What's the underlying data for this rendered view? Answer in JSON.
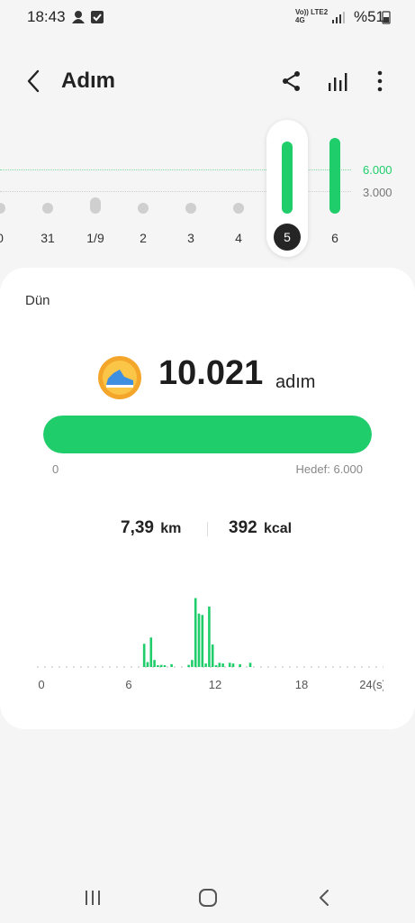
{
  "status": {
    "time": "18:43",
    "network": "Vo)) LTE2 4G",
    "battery": "%51",
    "icons": [
      "account-icon",
      "checkbox-icon",
      "volte-icon",
      "signal-icon",
      "battery-icon"
    ]
  },
  "header": {
    "title": "Adım",
    "icons": [
      "back-icon",
      "share-icon",
      "chart-icon",
      "more-icon"
    ]
  },
  "week": {
    "goal_label": "6.000",
    "ref_label": "3.000",
    "goal_color": "#1fce6b",
    "days": [
      {
        "label": "0",
        "steps": 0,
        "style": "dot"
      },
      {
        "label": "31",
        "steps": 0,
        "style": "dot"
      },
      {
        "label": "1/9",
        "steps": 2200,
        "style": "gray"
      },
      {
        "label": "2",
        "steps": 0,
        "style": "dot"
      },
      {
        "label": "3",
        "steps": 0,
        "style": "dot"
      },
      {
        "label": "4",
        "steps": 0,
        "style": "dot"
      },
      {
        "label": "5",
        "steps": 10021,
        "style": "green",
        "selected": true
      },
      {
        "label": "6",
        "steps": 10500,
        "style": "green"
      }
    ]
  },
  "summary": {
    "date": "Dün",
    "steps": "10.021",
    "unit": "adım",
    "progress_fraction": 1.0,
    "min_label": "0",
    "goal_label": "Hedef: 6.000",
    "distance_value": "7,39",
    "distance_unit": "km",
    "calories_value": "392",
    "calories_unit": "kcal",
    "accent": "#1fce6b",
    "medal_icon": "running-shoe-medal-icon"
  },
  "chart_data": {
    "type": "bar",
    "x_ticks": [
      "0",
      "6",
      "12",
      "18",
      "24(s)"
    ],
    "xlim": [
      0,
      24
    ],
    "ylim": [
      0,
      1
    ],
    "values": [
      0,
      0,
      0,
      0,
      0,
      0,
      0,
      0,
      0,
      0,
      0,
      0,
      0,
      0,
      0,
      0,
      0,
      0,
      0,
      0,
      0,
      0,
      0,
      0,
      0,
      0,
      0,
      0,
      0,
      0,
      0,
      0.33,
      0.07,
      0.42,
      0.1,
      0.02,
      0.03,
      0.02,
      0,
      0.04,
      0,
      0,
      0,
      0,
      0.03,
      0.1,
      0.98,
      0.76,
      0.74,
      0.05,
      0.86,
      0.32,
      0.02,
      0.06,
      0.05,
      0,
      0.06,
      0.05,
      0,
      0.04,
      0,
      0,
      0.06,
      0,
      0,
      0,
      0,
      0,
      0,
      0,
      0,
      0,
      0,
      0,
      0,
      0,
      0,
      0,
      0,
      0,
      0,
      0,
      0,
      0,
      0,
      0,
      0,
      0,
      0,
      0,
      0,
      0,
      0,
      0,
      0,
      0
    ]
  },
  "navbar": {
    "icons": [
      "recent-apps-icon",
      "home-icon",
      "back-nav-icon"
    ]
  }
}
